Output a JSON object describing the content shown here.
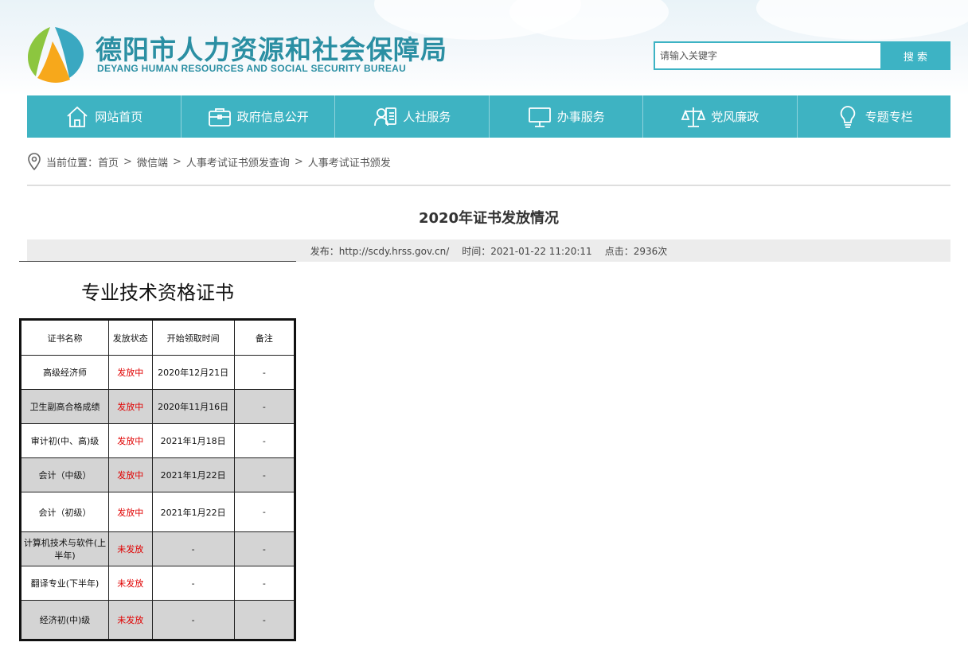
{
  "header": {
    "title": "德阳市人力资源和社会保障局",
    "subtitle": "DEYANG HUMAN RESOURCES AND SOCIAL SECURITY BUREAU",
    "search_placeholder": "请输入关键字",
    "search_button": "搜 索"
  },
  "colors": {
    "accent": "#3eb3c2",
    "status_red": "#e00000",
    "row_shade": "#d4d4d4"
  },
  "nav": [
    {
      "label": "网站首页",
      "icon": "home-icon"
    },
    {
      "label": "政府信息公开",
      "icon": "briefcase-icon"
    },
    {
      "label": "人社服务",
      "icon": "user-card-icon"
    },
    {
      "label": "办事服务",
      "icon": "monitor-icon"
    },
    {
      "label": "党风廉政",
      "icon": "scales-icon"
    },
    {
      "label": "专题专栏",
      "icon": "lightbulb-icon"
    }
  ],
  "breadcrumb": {
    "prefix": "当前位置：",
    "items": [
      "首页",
      "微信端",
      "人事考试证书颁发查询",
      "人事考试证书颁发"
    ],
    "separator": ">"
  },
  "article": {
    "title": "2020年证书发放情况",
    "publisher": "发布：http://scdy.hrss.gov.cn/",
    "time": "时间：2021-01-22 11:20:11",
    "clicks": "点击：2936次"
  },
  "content": {
    "heading": "专业技术资格证书",
    "table": {
      "headers": [
        "证书名称",
        "发放状态",
        "开始领取时间",
        "备注"
      ],
      "rows": [
        {
          "name": "高级经济师",
          "status": "发放中",
          "date": "2020年12月21日",
          "note": "-"
        },
        {
          "name": "卫生副高合格成绩",
          "status": "发放中",
          "date": "2020年11月16日",
          "note": "-"
        },
        {
          "name": "审计初(中、高)级",
          "status": "发放中",
          "date": "2021年1月18日",
          "note": "-"
        },
        {
          "name": "会计（中级）",
          "status": "发放中",
          "date": "2021年1月22日",
          "note": "-"
        },
        {
          "name": "会计（初级）",
          "status": "发放中",
          "date": "2021年1月22日",
          "note": "-"
        },
        {
          "name": "计算机技术与软件(上半年)",
          "status": "未发放",
          "date": "-",
          "note": "-"
        },
        {
          "name": "翻译专业(下半年)",
          "status": "未发放",
          "date": "-",
          "note": "-"
        },
        {
          "name": "经济初(中)级",
          "status": "未发放",
          "date": "-",
          "note": "-"
        }
      ]
    }
  }
}
